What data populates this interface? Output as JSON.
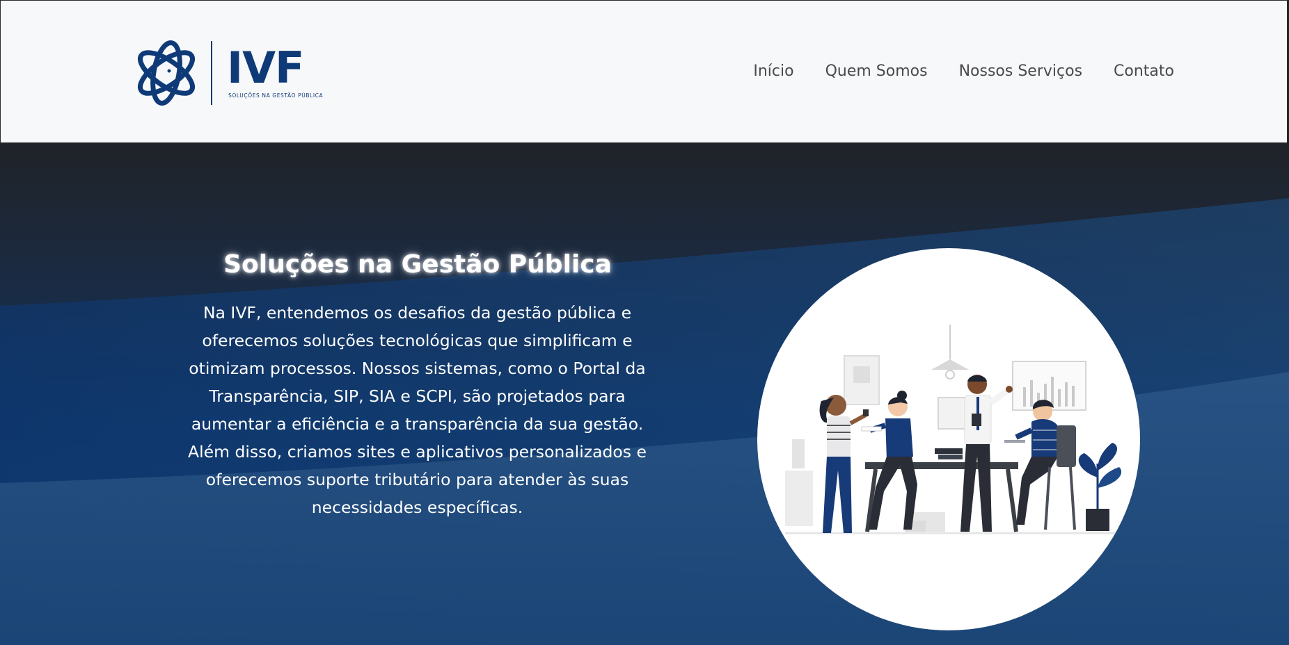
{
  "brand": {
    "name": "IVF",
    "tagline": "SOLUÇÕES NA GESTÃO PÚBLICA",
    "primary_color": "#0f3a78"
  },
  "nav": {
    "items": [
      {
        "label": "Início"
      },
      {
        "label": "Quem Somos"
      },
      {
        "label": "Nossos Serviços"
      },
      {
        "label": "Contato"
      }
    ]
  },
  "hero": {
    "title": "Soluções na Gestão Pública",
    "text": "Na IVF, entendemos os desafios da gestão pública e oferecemos soluções tecnológicas que simplificam e otimizam processos. Nossos sistemas, como o Portal da Transparência, SIP, SIA e SCPI, são projetados para aumentar a eficiência e a transparência da sua gestão. Além disso, criamos sites e aplicativos personalizados e oferecemos suporte tributário para atender às suas necessidades específicas.",
    "illustration": "team-meeting-illustration",
    "background_colors": [
      "#202328",
      "#0f3466",
      "#1a4a7a"
    ]
  }
}
